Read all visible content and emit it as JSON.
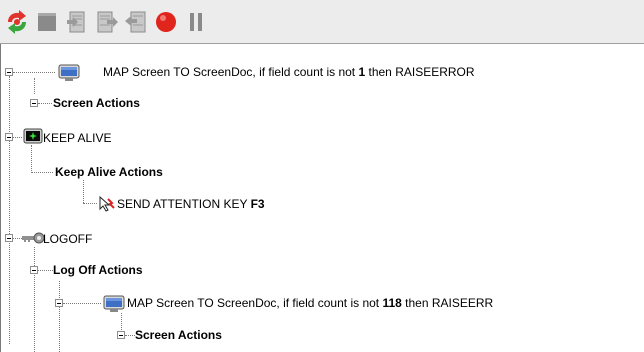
{
  "toolbar": {
    "buttons": [
      {
        "icon": "run-macro-icon"
      },
      {
        "icon": "stop-icon"
      },
      {
        "icon": "step-into-icon"
      },
      {
        "icon": "step-over-icon"
      },
      {
        "icon": "step-out-icon"
      },
      {
        "icon": "record-icon"
      },
      {
        "icon": "pause-icon"
      }
    ]
  },
  "tree": {
    "node1": {
      "prefix": "MAP Screen TO ScreenDoc, if field count is not",
      "value": "1",
      "suffix": "then RAISEERROR"
    },
    "node2": {
      "label": "Screen Actions"
    },
    "node3": {
      "label": "KEEP ALIVE"
    },
    "node4": {
      "label": "Keep Alive Actions"
    },
    "node5": {
      "prefix": "SEND ATTENTION KEY",
      "value": "F3"
    },
    "node6": {
      "label": "LOGOFF"
    },
    "node7": {
      "label": "Log Off Actions"
    },
    "node8": {
      "prefix": "MAP Screen TO ScreenDoc, if field count is not",
      "value": "118",
      "suffix": "then RAISEERR"
    },
    "node9": {
      "label": "Screen Actions"
    }
  }
}
